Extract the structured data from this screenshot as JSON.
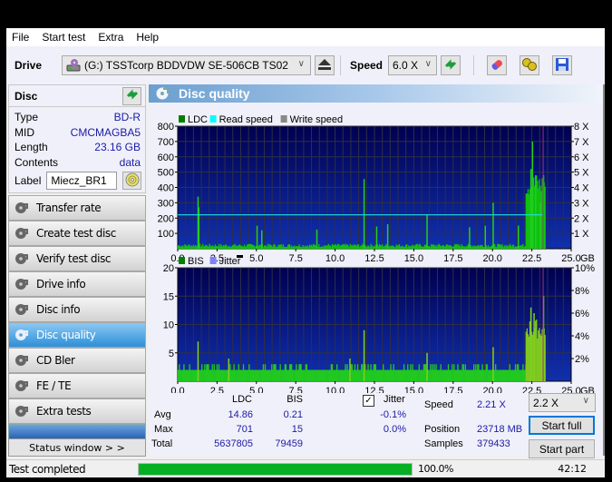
{
  "menu": [
    "File",
    "Start test",
    "Extra",
    "Help"
  ],
  "toolbar": {
    "drive_label": "Drive",
    "drive_value": "(G:)  TSSTcorp BDDVDW SE-506CB TS02",
    "speed_label": "Speed",
    "speed_value": "6.0 X",
    "icons": [
      "eject-icon",
      "refresh-icon",
      "erase-icon",
      "settings-icon",
      "save-icon"
    ]
  },
  "disc": {
    "title": "Disc",
    "rows": [
      {
        "key": "Type",
        "value": "BD-R"
      },
      {
        "key": "MID",
        "value": "CMCMAGBA5"
      },
      {
        "key": "Length",
        "value": "23.16 GB"
      },
      {
        "key": "Contents",
        "value": "data"
      }
    ],
    "label_key": "Label",
    "label_value": "Miecz_BR1"
  },
  "nav": {
    "items": [
      {
        "label": "Transfer rate",
        "active": false
      },
      {
        "label": "Create test disc",
        "active": false
      },
      {
        "label": "Verify test disc",
        "active": false
      },
      {
        "label": "Drive info",
        "active": false
      },
      {
        "label": "Disc info",
        "active": false
      },
      {
        "label": "Disc quality",
        "active": true
      },
      {
        "label": "CD Bler",
        "active": false
      },
      {
        "label": "FE / TE",
        "active": false
      },
      {
        "label": "Extra tests",
        "active": false
      }
    ],
    "status_window": "Status window > >"
  },
  "main": {
    "title": "Disc quality"
  },
  "chart_data": [
    {
      "type": "bar",
      "title": "LDC",
      "legend": [
        "LDC",
        "Read speed",
        "Write speed"
      ],
      "legend_colors": [
        "#008000",
        "#00ffff",
        "#888888"
      ],
      "legend_placement": "top-left",
      "xlabel": "GB",
      "xlim": [
        0,
        25
      ],
      "xticks": [
        "0.0",
        "2.5",
        "5.0",
        "7.5",
        "10.0",
        "12.5",
        "15.0",
        "17.5",
        "20.0",
        "22.5",
        "25.0"
      ],
      "ylim_left": [
        0,
        800
      ],
      "yticks_left": [
        "100",
        "200",
        "300",
        "400",
        "500",
        "600",
        "700",
        "800"
      ],
      "ylim_right": [
        0,
        8
      ],
      "yticks_right": [
        "1 X",
        "2 X",
        "3 X",
        "4 X",
        "5 X",
        "6 X",
        "7 X",
        "8 X"
      ],
      "grid": true,
      "ldc_spikes": [
        {
          "x": 1.25,
          "y": 340
        },
        {
          "x": 1.3,
          "y": 270
        },
        {
          "x": 5.0,
          "y": 150
        },
        {
          "x": 5.3,
          "y": 120
        },
        {
          "x": 8.8,
          "y": 125
        },
        {
          "x": 11.8,
          "y": 455
        },
        {
          "x": 12.6,
          "y": 145
        },
        {
          "x": 13.3,
          "y": 160
        },
        {
          "x": 15.8,
          "y": 220
        },
        {
          "x": 18.5,
          "y": 140
        },
        {
          "x": 20.0,
          "y": 300
        },
        {
          "x": 19.5,
          "y": 150
        },
        {
          "x": 21.6,
          "y": 150
        },
        {
          "x": 22.5,
          "y": 700
        },
        {
          "x": 22.4,
          "y": 520
        },
        {
          "x": 22.7,
          "y": 480
        },
        {
          "x": 23.0,
          "y": 300
        },
        {
          "x": 23.2,
          "y": 480
        }
      ],
      "ldc_baseline": 25,
      "ldc_end_block": {
        "from": 22.1,
        "to": 23.3,
        "level": 450
      },
      "read_speed_x": 2.21,
      "read_speed_end": 23.16,
      "position_marker": 23.16
    },
    {
      "type": "bar",
      "title": "BIS",
      "legend": [
        "BIS",
        "Jitter"
      ],
      "legend_colors": [
        "#008000",
        "#8080ff"
      ],
      "legend_placement": "top-left",
      "xlabel": "GB",
      "xlim": [
        0,
        25
      ],
      "xticks": [
        "0.0",
        "2.5",
        "5.0",
        "7.5",
        "10.0",
        "12.5",
        "15.0",
        "17.5",
        "20.0",
        "22.5",
        "25.0"
      ],
      "ylim_left": [
        0,
        20
      ],
      "yticks_left": [
        "5",
        "10",
        "15",
        "20"
      ],
      "ylim_right": [
        0,
        10
      ],
      "yticks_right": [
        "2%",
        "4%",
        "6%",
        "8%",
        "10%"
      ],
      "grid": true,
      "bis_spikes": [
        {
          "x": 1.25,
          "y": 7
        },
        {
          "x": 11.8,
          "y": 9
        },
        {
          "x": 3.2,
          "y": 4
        },
        {
          "x": 10.9,
          "y": 4
        },
        {
          "x": 15.8,
          "y": 5
        },
        {
          "x": 20.0,
          "y": 6
        },
        {
          "x": 22.4,
          "y": 13
        },
        {
          "x": 22.6,
          "y": 12
        },
        {
          "x": 23.2,
          "y": 15
        }
      ],
      "bis_baseline": 2,
      "bis_end_block": {
        "from": 22.1,
        "to": 23.3,
        "level": 10
      },
      "position_marker": 23.16
    }
  ],
  "stats": {
    "col_ldc": "LDC",
    "col_bis": "BIS",
    "jitter_label": "Jitter",
    "jitter_checked": true,
    "rows": [
      {
        "label": "Avg",
        "ldc": "14.86",
        "bis": "0.21",
        "jitter": "-0.1%"
      },
      {
        "label": "Max",
        "ldc": "701",
        "bis": "15",
        "jitter": "0.0%"
      },
      {
        "label": "Total",
        "ldc": "5637805",
        "bis": "79459",
        "jitter": ""
      }
    ],
    "speed_label": "Speed",
    "speed_value": "2.21 X",
    "position_label": "Position",
    "position_value": "23718 MB",
    "samples_label": "Samples",
    "samples_value": "379433",
    "speed_select": "2.2 X",
    "start_full": "Start full",
    "start_part": "Start part"
  },
  "statusbar": {
    "text": "Test completed",
    "progress_percent": 100,
    "progress_label": "100.0%",
    "elapsed": "42:12"
  }
}
